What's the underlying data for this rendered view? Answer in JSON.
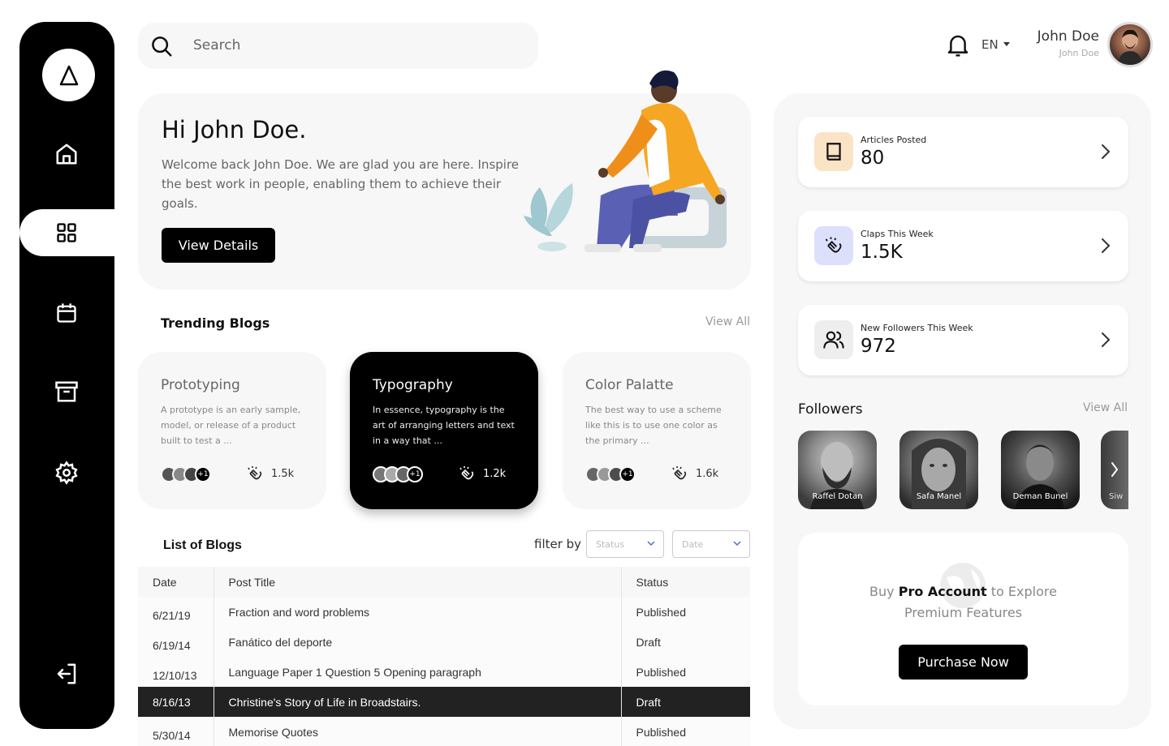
{
  "search": {
    "placeholder": "Search"
  },
  "header": {
    "language": "EN",
    "user_name": "John Doe",
    "user_sub": "John Doe"
  },
  "hero": {
    "title": "Hi John Doe.",
    "text": "Welcome back John Doe. We are glad you are here. Inspire the best work in people, enabling them to achieve their goals.",
    "button": "View Details"
  },
  "trending": {
    "title": "Trending Blogs",
    "view_all": "View All",
    "cards": [
      {
        "title": "Prototyping",
        "text": "A prototype is an early sample, model, or release of a product built to test a ...",
        "more": "+1",
        "claps": "1.5k"
      },
      {
        "title": "Typography",
        "text": "In essence, typography is the art of arranging letters and text in a way that ...",
        "more": "+1",
        "claps": "1.2k"
      },
      {
        "title": "Color Palatte",
        "text": "The best way to use a scheme like this is to use one color as the primary ...",
        "more": "+1",
        "claps": "1.6k"
      }
    ]
  },
  "list": {
    "title": "List of Blogs",
    "filter_label": "filter by",
    "filters": [
      "Status",
      "Date"
    ],
    "columns": [
      "Date",
      "Post Title",
      "Status"
    ],
    "rows": [
      {
        "date": "6/21/19",
        "title": "Fraction and word problems",
        "status": "Published"
      },
      {
        "date": "6/19/14",
        "title": "Fanático del deporte",
        "status": "Draft"
      },
      {
        "date": "12/10/13",
        "title": "Language Paper 1 Question 5 Opening paragraph",
        "status": "Published"
      },
      {
        "date": "8/16/13",
        "title": "Christine's Story of Life in Broadstairs.",
        "status": "Draft"
      },
      {
        "date": "5/30/14",
        "title": "Memorise Quotes",
        "status": "Published"
      }
    ]
  },
  "stats": [
    {
      "label": "Articles Posted",
      "value": "80",
      "icon": "book-icon",
      "color": "#fbe3c6"
    },
    {
      "label": "Claps This Week",
      "value": "1.5K",
      "icon": "clap-icon",
      "color": "#dce0fb"
    },
    {
      "label": "New Followers This Week",
      "value": "972",
      "icon": "users-icon",
      "color": "#eeeeee"
    }
  ],
  "followers": {
    "title": "Followers",
    "view_all": "View All",
    "items": [
      {
        "name": "Raffel Dotan"
      },
      {
        "name": "Safa Manel"
      },
      {
        "name": "Deman Bunel"
      },
      {
        "name": "Siw"
      }
    ]
  },
  "promo": {
    "text_1": "Buy ",
    "text_bold": "Pro Account",
    "text_2": " to Explore",
    "text_3": "Premium Features",
    "button": "Purchase Now"
  }
}
